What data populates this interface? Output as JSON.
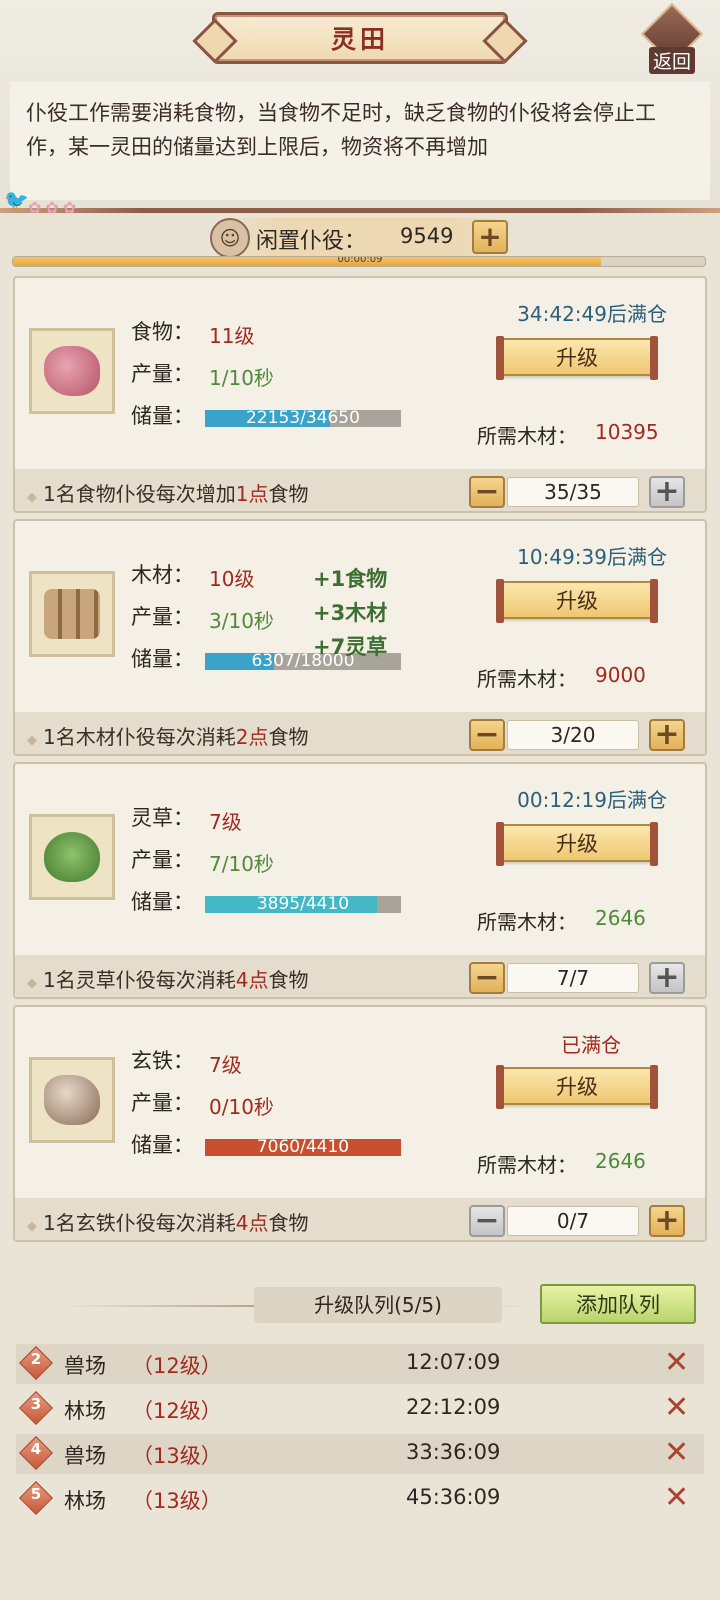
{
  "header": {
    "title": "灵田",
    "back_label": "返回"
  },
  "notice": {
    "text": "仆役工作需要消耗食物，当食物不足时，缺乏食物的仆役将会停止工作，某一灵田的储量达到上限后，物资将不再增加"
  },
  "idle": {
    "label": "闲置仆役：",
    "value": "9549",
    "timer": "00:00:09",
    "timer_progress": 0.85
  },
  "labels": {
    "production": "产量：",
    "storage": "储量：",
    "wood_needed": "所需木材：",
    "upgrade": "升级"
  },
  "fields": [
    {
      "name": "食物：",
      "level": "11级",
      "rate": "1/10秒",
      "storage": "22153/34650",
      "fill": 0.64,
      "fill_color": "#3aa3c8",
      "full_text": "34:42:49后满仓",
      "wood": "10395",
      "desc_pre": "1名食物仆役每次增加",
      "desc_hl": "1点",
      "desc_post": "食物",
      "count": "35/35"
    },
    {
      "name": "木材：",
      "level": "10级",
      "rate": "3/10秒",
      "storage": "6307/18000",
      "fill": 0.35,
      "fill_color": "#3aa3c8",
      "full_text": "10:49:39后满仓",
      "wood": "9000",
      "desc_pre": "1名木材仆役每次消耗",
      "desc_hl": "2点",
      "desc_post": "食物",
      "count": "3/20"
    },
    {
      "name": "灵草：",
      "level": "7级",
      "rate": "7/10秒",
      "storage": "3895/4410",
      "fill": 0.88,
      "fill_color": "#45b8c6",
      "full_text": "00:12:19后满仓",
      "wood": "2646",
      "desc_pre": "1名灵草仆役每次消耗",
      "desc_hl": "4点",
      "desc_post": "食物",
      "count": "7/7"
    },
    {
      "name": "玄铁：",
      "level": "7级",
      "rate": "0/10秒",
      "storage": "7060/4410",
      "fill": 1.0,
      "fill_color": "#c8502e",
      "full_text": "已满仓",
      "wood": "2646",
      "desc_pre": "1名玄铁仆役每次消耗",
      "desc_hl": "4点",
      "desc_post": "食物",
      "count": "0/7"
    }
  ],
  "floating_gains": [
    "+1食物",
    "+3木材",
    "+7灵草"
  ],
  "queue": {
    "title": "升级队列(5/5)",
    "add_label": "添加队列",
    "items": [
      {
        "num": "2",
        "name": "兽场",
        "level": "（12级）",
        "time": "12:07:09"
      },
      {
        "num": "3",
        "name": "林场",
        "level": "（12级）",
        "time": "22:12:09"
      },
      {
        "num": "4",
        "name": "兽场",
        "level": "（13级）",
        "time": "33:36:09"
      },
      {
        "num": "5",
        "name": "林场",
        "level": "（13级）",
        "time": "45:36:09"
      }
    ]
  }
}
